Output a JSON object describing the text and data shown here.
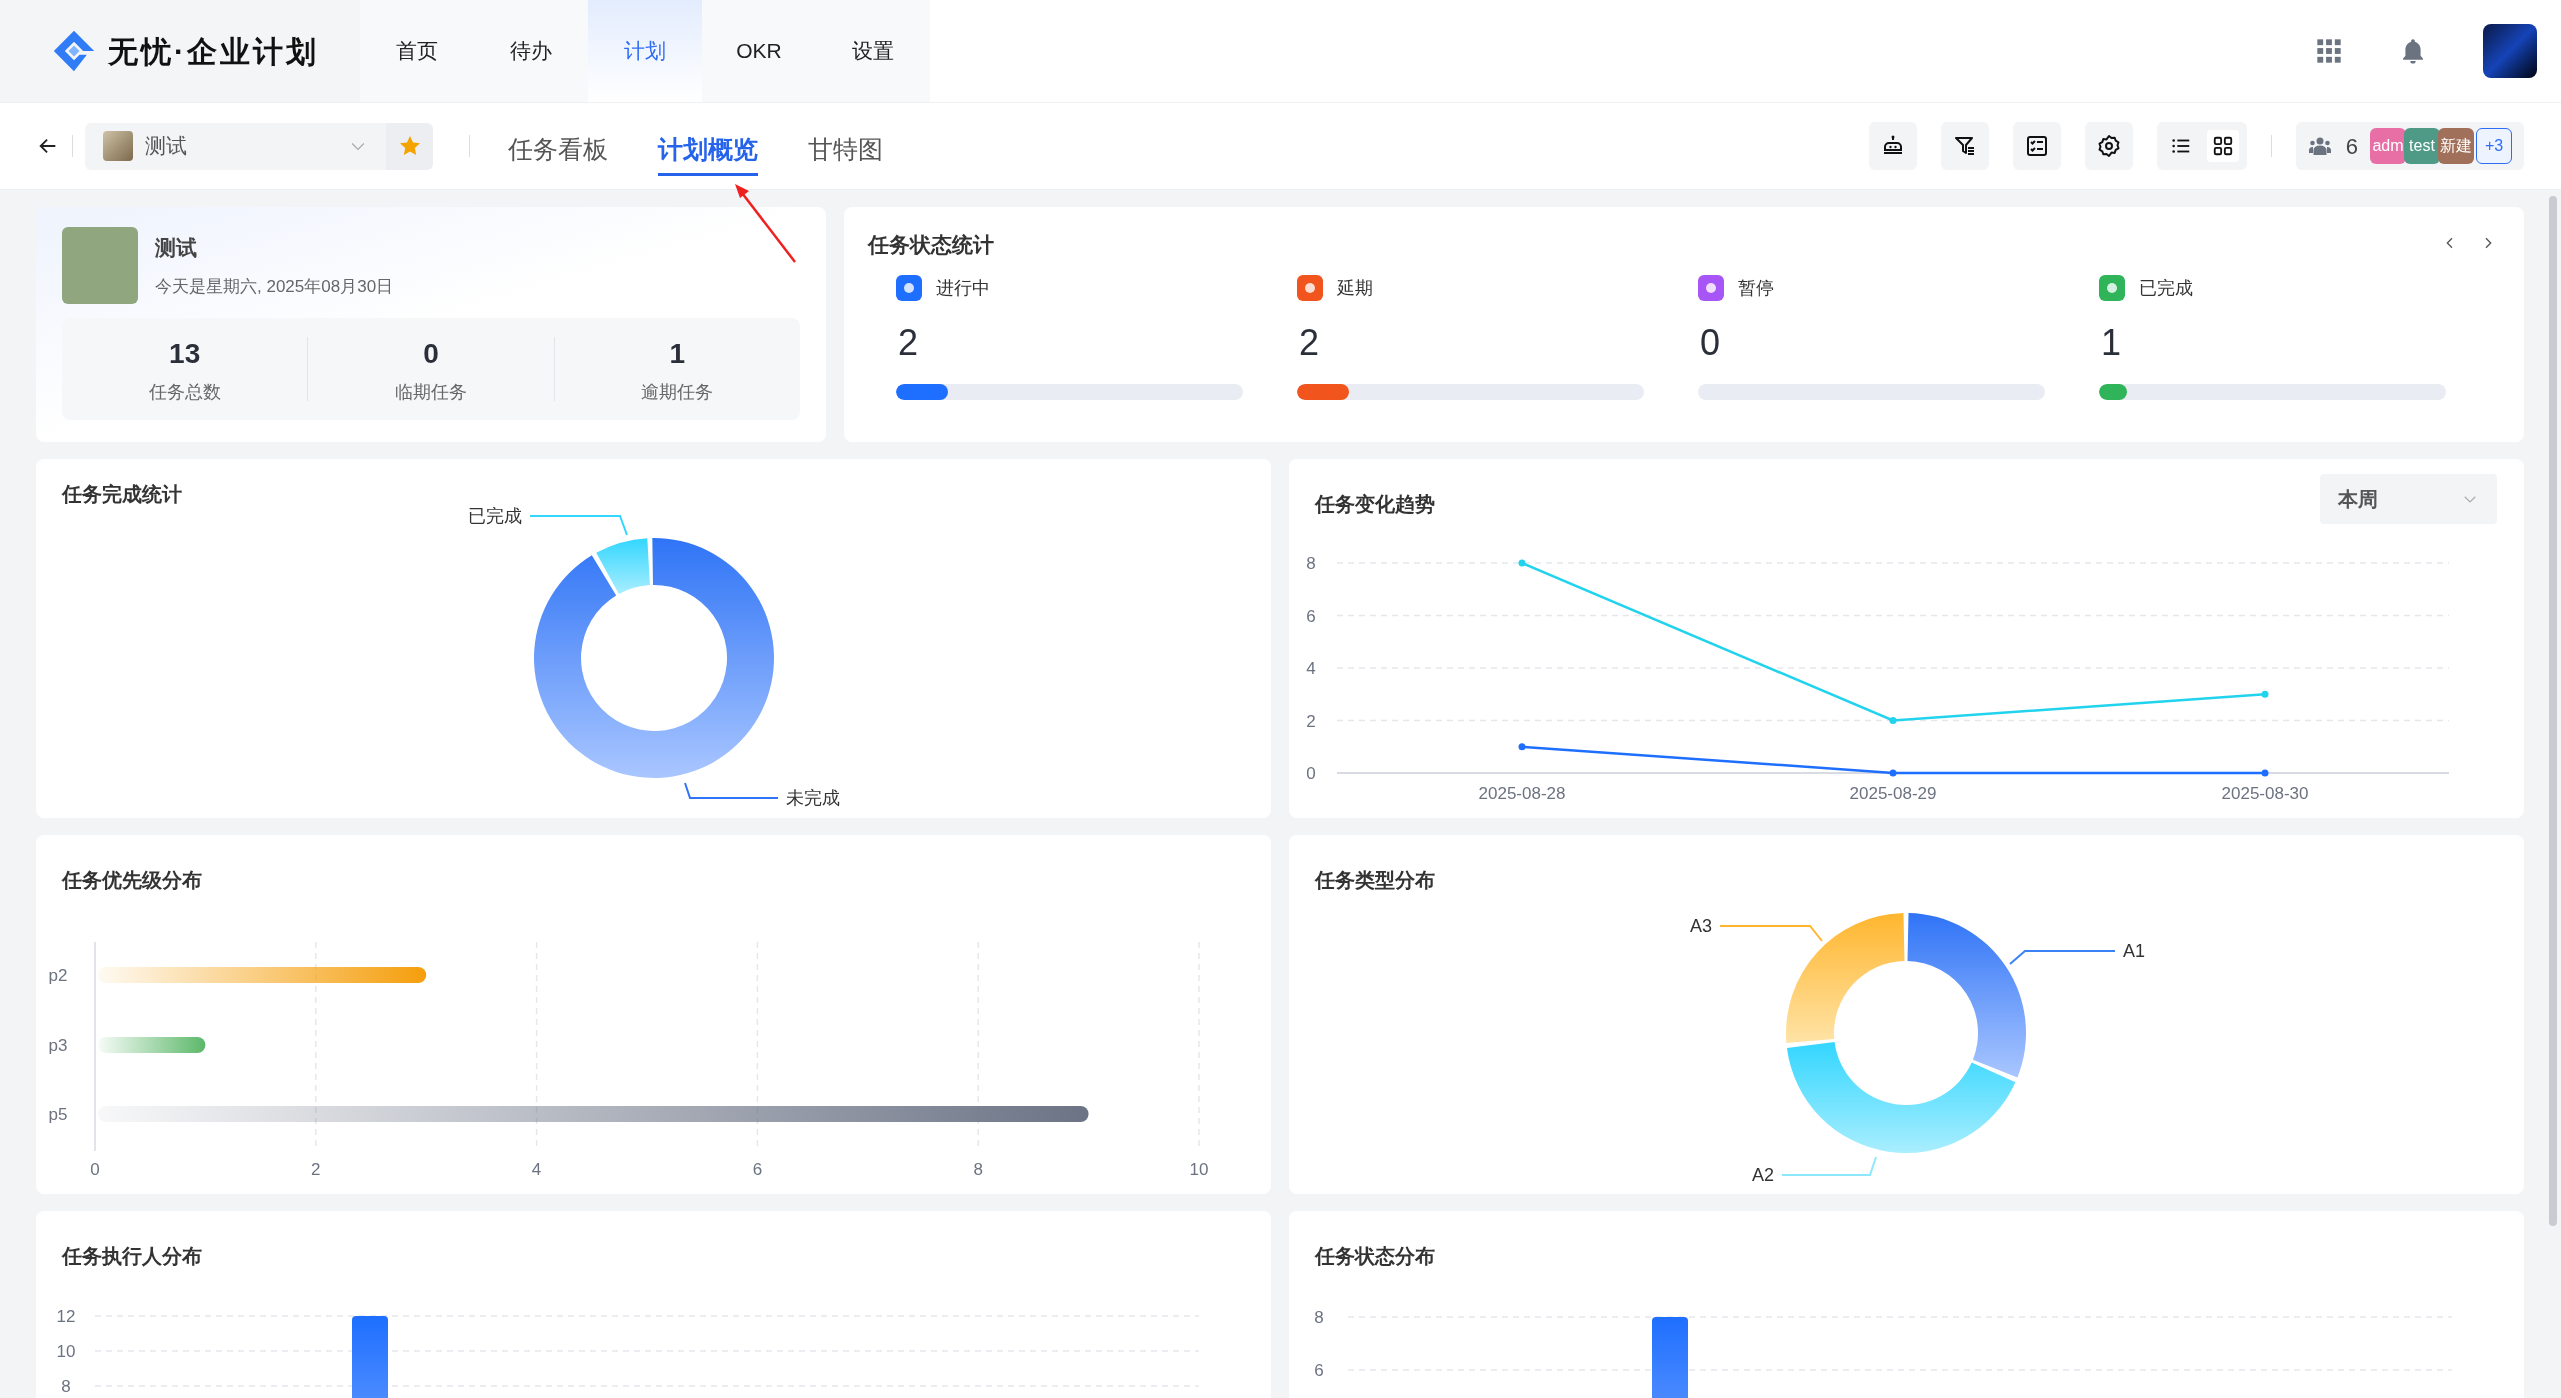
{
  "header": {
    "logo": "无忧·企业计划",
    "nav": [
      {
        "label": "首页",
        "selected": false
      },
      {
        "label": "待办",
        "selected": false
      },
      {
        "label": "计划",
        "selected": true
      },
      {
        "label": "OKR",
        "selected": false
      },
      {
        "label": "设置",
        "selected": false
      }
    ]
  },
  "subbar": {
    "project": "测试",
    "starred": true,
    "tabs": [
      {
        "label": "任务看板",
        "selected": false
      },
      {
        "label": "计划概览",
        "selected": true
      },
      {
        "label": "甘特图",
        "selected": false
      }
    ],
    "view_toggle": [
      {
        "kind": "list",
        "selected": false
      },
      {
        "kind": "grid",
        "selected": true
      }
    ],
    "member_count": "6",
    "members": [
      {
        "label": "adm",
        "color": "#e86fa6"
      },
      {
        "label": "test",
        "color": "#4f9a87"
      },
      {
        "label": "新建",
        "color": "#a0705a"
      }
    ],
    "more_members": "+3"
  },
  "summary": {
    "name": "测试",
    "date": "今天是星期六, 2025年08月30日",
    "stats": [
      {
        "value": "13",
        "label": "任务总数"
      },
      {
        "value": "0",
        "label": "临期任务"
      },
      {
        "value": "1",
        "label": "逾期任务"
      }
    ]
  },
  "status_stats": {
    "title": "任务状态统计",
    "items": [
      {
        "label": "进行中",
        "count": "2",
        "level": 0.15,
        "color": "#1e6fff"
      },
      {
        "label": "延期",
        "count": "2",
        "level": 0.15,
        "color": "#f1541c"
      },
      {
        "label": "暂停",
        "count": "0",
        "level": 0,
        "color": "#a855f7"
      },
      {
        "label": "已完成",
        "count": "1",
        "level": 0.08,
        "color": "#2fb45a"
      }
    ]
  },
  "completion": {
    "title": "任务完成统计",
    "segments": [
      {
        "label": "未完成"
      },
      {
        "label": "已完成"
      }
    ]
  },
  "trend": {
    "title": "任务变化趋势",
    "period": "本周",
    "chart_data": {
      "type": "line",
      "x": [
        "2025-08-28",
        "2025-08-29",
        "2025-08-30"
      ],
      "series": [
        {
          "color": "#22d3ee",
          "values": [
            8,
            2,
            3
          ],
          "marker": true
        },
        {
          "color": "#1e6fff",
          "values": [
            1,
            0,
            0
          ],
          "marker": true
        }
      ],
      "yticks": [
        0,
        2,
        4,
        6,
        8
      ],
      "ylim": [
        0,
        8
      ],
      "grid": true
    }
  },
  "priority": {
    "title": "任务优先级分布",
    "chart_data": {
      "type": "bar",
      "orientation": "horizontal",
      "categories": [
        "p2",
        "p3",
        "p5"
      ],
      "values": [
        3,
        1,
        9
      ],
      "xticks": [
        0,
        2,
        4,
        6,
        8,
        10
      ],
      "xlim": [
        0,
        10
      ],
      "grid": true
    }
  },
  "types": {
    "title": "任务类型分布",
    "segments": [
      {
        "label": "A1"
      },
      {
        "label": "A2"
      },
      {
        "label": "A3"
      }
    ]
  },
  "executor": {
    "title": "任务执行人分布",
    "chart_data": {
      "type": "bar",
      "values": [
        12
      ],
      "yticks": [
        8,
        10,
        12
      ],
      "ylim": [
        0,
        12
      ],
      "grid": true
    }
  },
  "status_dist": {
    "title": "任务状态分布",
    "chart_data": {
      "type": "bar",
      "values": [
        8
      ],
      "yticks": [
        6,
        8
      ],
      "ylim": [
        0,
        8
      ],
      "grid": true
    }
  }
}
